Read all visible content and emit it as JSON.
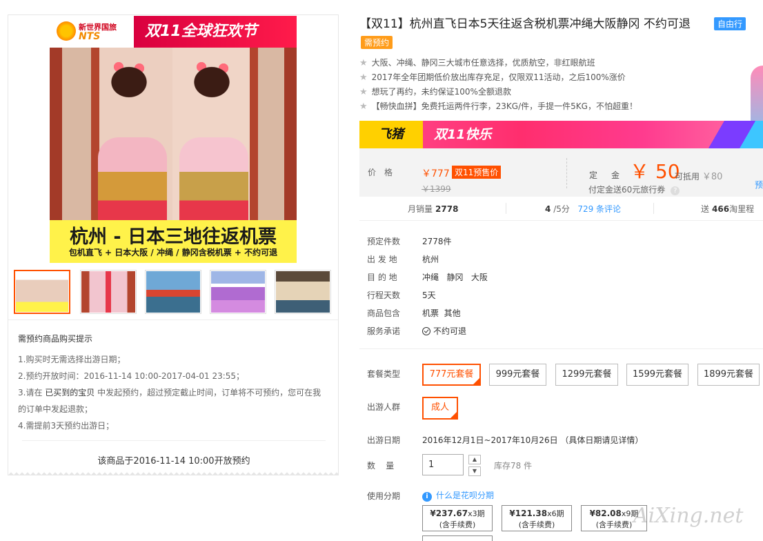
{
  "gallery": {
    "logo_line1": "新世界国旅",
    "logo_line2": "NTS",
    "banner_text": "双11全球狂欢节",
    "caption_line1": "杭州 - 日本三地往返机票",
    "caption_line2": "包机直飞 + 日本大阪 / 冲绳 / 静冈含税机票 + 不约可退"
  },
  "tips": {
    "title": "需预约商品购买提示",
    "line1": "1.购买时无需选择出游日期；",
    "line2": "2.预约开放时间：2016-11-14 10:00-2017-04-01 23:55；",
    "line3_a": "3.请在",
    "line3_b": "已买到的宝贝",
    "line3_c": "中发起预约，超过预定截止时间，订单将不可预约，您可在我",
    "line3_d": "的订单中发起退款；",
    "line4": "4.需提前3天预约出游日；",
    "open_note": "该商品于2016-11-14 10:00开放预约"
  },
  "product": {
    "title": "【双11】杭州直飞日本5天往返含税机票冲绳大阪静冈 不约可退",
    "badge_free": "自由行",
    "badge_pre": "需预约",
    "features": [
      "大阪、冲绳、静冈三大城市任意选择，优质航空，非红眼航班",
      "2017年全年团期低价放出库存充足，仅限双11活动，之后100%涨价",
      "想玩了再约，未约保证100%全额退款",
      "【畅快血拼】免费托运两件行李，23KG/件，手提一件5KG，不怕超重！"
    ]
  },
  "promo": {
    "brand": "飞猪",
    "text": "双11快乐"
  },
  "price": {
    "label": "价格",
    "now": "￥777",
    "tag": "双11预售价",
    "old": "￥1399",
    "deposit_label": "定金",
    "deposit": "￥ 50",
    "usable_prefix": "可抵用",
    "usable_amount": "￥80",
    "coupon": "付定金送60元旅行券",
    "help_glyph": "?",
    "pre_link": "预"
  },
  "stats": {
    "sales_label": "月销量",
    "sales": "2778",
    "score": "4",
    "score_suffix": "/5分",
    "reviews": "729 条评论",
    "points_prefix": "送",
    "points": "466",
    "points_suffix": "淘里程"
  },
  "info": [
    {
      "k": "预定件数",
      "v": "2778件"
    },
    {
      "k": "出 发 地",
      "v": "杭州"
    },
    {
      "k": "目 的 地",
      "v": "冲绳   静冈   大阪"
    },
    {
      "k": "行程天数",
      "v": "5天"
    },
    {
      "k": "商品包含",
      "v": "机票  其他"
    },
    {
      "k": "服务承诺",
      "v": "不约可退"
    }
  ],
  "options": {
    "package_label": "套餐类型",
    "packages": [
      "777元套餐",
      "999元套餐",
      "1299元套餐",
      "1599元套餐",
      "1899元套餐"
    ],
    "crowd_label": "出游人群",
    "crowd": "成人",
    "date_label": "出游日期",
    "date_value": "2016年12月1日~2017年10月26日 （具体日期请见详情）",
    "qty_label": "数    量",
    "qty_value": "1",
    "stock": "库存78 件",
    "installment_label": "使用分期",
    "huabei_link": "什么是花呗分期",
    "installments": [
      {
        "amount": "¥237.67",
        "period": "x3期",
        "fee": "(含手续费)"
      },
      {
        "amount": "¥121.38",
        "period": "x6期",
        "fee": "(含手续费)"
      },
      {
        "amount": "¥82.08",
        "period": "x9期",
        "fee": "(含手续费)"
      }
    ]
  },
  "watermark": "AiXing.net"
}
